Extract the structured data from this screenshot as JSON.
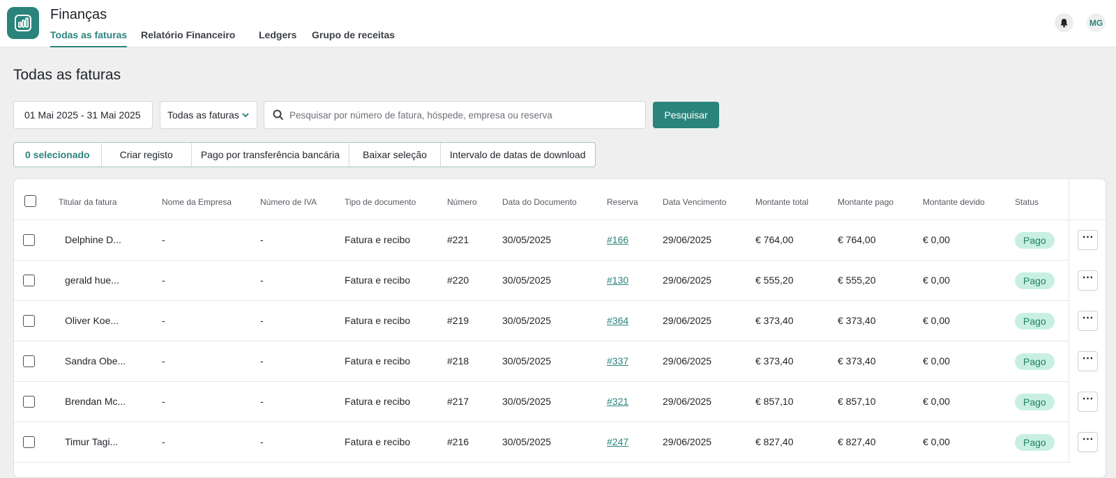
{
  "app": {
    "title": "Finanças",
    "user_initials": "MG"
  },
  "nav": {
    "tabs": [
      {
        "label": "Todas as faturas"
      },
      {
        "label": "Relatório Financeiro"
      },
      {
        "label": "Ledgers"
      },
      {
        "label": "Grupo de receitas"
      }
    ]
  },
  "page": {
    "title": "Todas as faturas"
  },
  "filters": {
    "date_range": "01 Mai 2025 - 31 Mai 2025",
    "type_selected": "Todas as faturas",
    "search_placeholder": "Pesquisar por número de fatura, hóspede, empresa ou reserva",
    "search_value": "",
    "search_button": "Pesquisar"
  },
  "actions": {
    "selected_count": "0 selecionado",
    "create_record": "Criar registo",
    "paid_by_transfer": "Pago por transferência bancária",
    "download_selection": "Baixar seleção",
    "download_date_range": "Intervalo de datas de download"
  },
  "table": {
    "columns": [
      "Titular da fatura",
      "Nome da Empresa",
      "Número de IVA",
      "Tipo de documento",
      "Número",
      "Data do Documento",
      "Reserva",
      "Data Vencimento",
      "Montante total",
      "Montante pago",
      "Montante devido",
      "Status"
    ],
    "rows": [
      {
        "holder": "Delphine D...",
        "company": "-",
        "vat": "-",
        "doc_type": "Fatura e recibo",
        "number": "#221",
        "doc_date": "30/05/2025",
        "reservation": "#166",
        "due_date": "29/06/2025",
        "total": "€ 764,00",
        "paid": "€ 764,00",
        "owed": "€ 0,00",
        "status": "Pago"
      },
      {
        "holder": "gerald hue...",
        "company": "-",
        "vat": "-",
        "doc_type": "Fatura e recibo",
        "number": "#220",
        "doc_date": "30/05/2025",
        "reservation": "#130",
        "due_date": "29/06/2025",
        "total": "€ 555,20",
        "paid": "€ 555,20",
        "owed": "€ 0,00",
        "status": "Pago"
      },
      {
        "holder": "Oliver Koe...",
        "company": "-",
        "vat": "-",
        "doc_type": "Fatura e recibo",
        "number": "#219",
        "doc_date": "30/05/2025",
        "reservation": "#364",
        "due_date": "29/06/2025",
        "total": "€ 373,40",
        "paid": "€ 373,40",
        "owed": "€ 0,00",
        "status": "Pago"
      },
      {
        "holder": "Sandra Obe...",
        "company": "-",
        "vat": "-",
        "doc_type": "Fatura e recibo",
        "number": "#218",
        "doc_date": "30/05/2025",
        "reservation": "#337",
        "due_date": "29/06/2025",
        "total": "€ 373,40",
        "paid": "€ 373,40",
        "owed": "€ 0,00",
        "status": "Pago"
      },
      {
        "holder": "Brendan Mc...",
        "company": "-",
        "vat": "-",
        "doc_type": "Fatura e recibo",
        "number": "#217",
        "doc_date": "30/05/2025",
        "reservation": "#321",
        "due_date": "29/06/2025",
        "total": "€ 857,10",
        "paid": "€ 857,10",
        "owed": "€ 0,00",
        "status": "Pago"
      },
      {
        "holder": "Timur Tagi...",
        "company": "-",
        "vat": "-",
        "doc_type": "Fatura e recibo",
        "number": "#216",
        "doc_date": "30/05/2025",
        "reservation": "#247",
        "due_date": "29/06/2025",
        "total": "€ 827,40",
        "paid": "€ 827,40",
        "owed": "€ 0,00",
        "status": "Pago"
      }
    ],
    "more_icon": "⋯"
  },
  "colors": {
    "accent": "#2a847b",
    "badge_bg": "#c8f0e0",
    "badge_text": "#1f7f63"
  }
}
